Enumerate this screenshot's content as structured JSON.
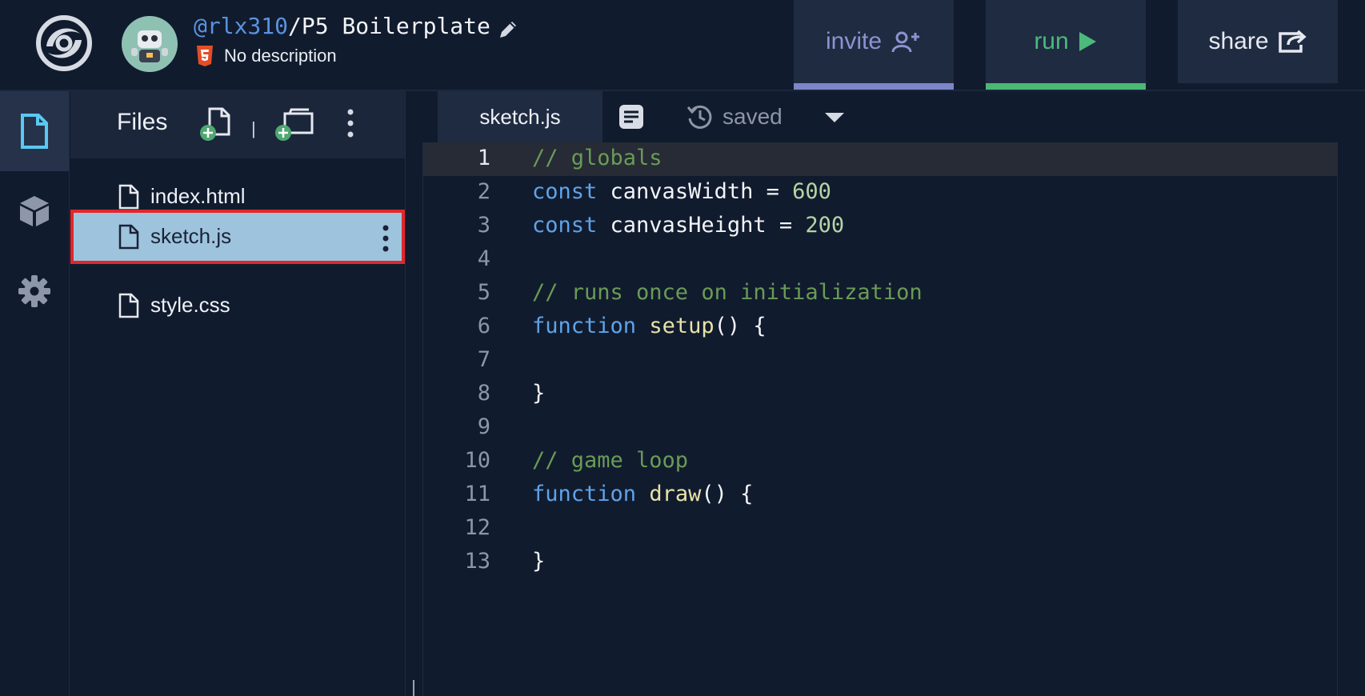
{
  "header": {
    "user": "@rlx310",
    "project_name": "/P5 Boilerplate",
    "description": "No description",
    "invite_label": "invite",
    "run_label": "run",
    "share_label": "share"
  },
  "sidebar": {
    "files_label": "Files",
    "separator": "|",
    "files": [
      {
        "name": "index.html"
      },
      {
        "name": "sketch.js"
      },
      {
        "name": "style.css"
      }
    ]
  },
  "editor": {
    "active_tab": "sketch.js",
    "save_status": "saved",
    "lines": [
      {
        "n": "1"
      },
      {
        "n": "2"
      },
      {
        "n": "3"
      },
      {
        "n": "4"
      },
      {
        "n": "5"
      },
      {
        "n": "6"
      },
      {
        "n": "7"
      },
      {
        "n": "8"
      },
      {
        "n": "9"
      },
      {
        "n": "10"
      },
      {
        "n": "11"
      },
      {
        "n": "12"
      },
      {
        "n": "13"
      }
    ],
    "tokens": {
      "c1": "// globals",
      "kw_const": "const",
      "id_w": " canvasWidth = ",
      "v_w": "600",
      "id_h": " canvasHeight = ",
      "v_h": "200",
      "c5": "// runs once on initialization",
      "kw_function": "function",
      "fn_setup": "setup",
      "sig": "() {",
      "close": "}",
      "c10": "// game loop",
      "fn_draw": "draw"
    }
  },
  "colors": {
    "background": "#111b2e",
    "accent_invite": "#7d86c9",
    "accent_run": "#4bb873",
    "selected_file": "#9ec4dd",
    "selection_outline": "#e0272b",
    "comment": "#6a9b56",
    "keyword": "#5fa3e8"
  },
  "icons": [
    "logo-icon",
    "avatar-robot-icon",
    "pencil-icon",
    "html5-icon",
    "add-user-icon",
    "play-icon",
    "share-icon",
    "file-icon",
    "cube-icon",
    "gear-icon",
    "new-file-icon",
    "new-folder-icon",
    "kebab-icon",
    "format-icon",
    "history-icon",
    "chevron-down-icon"
  ]
}
